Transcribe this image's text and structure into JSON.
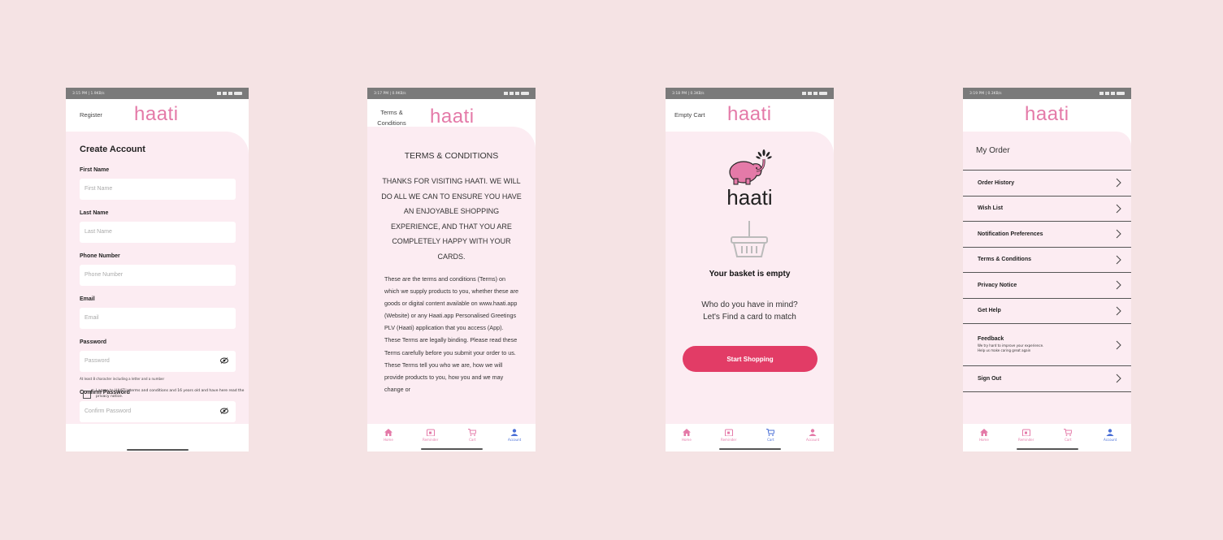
{
  "brand": {
    "logo": "haati",
    "accent": "#e47aa8",
    "button": "#e23c66",
    "active_nav": "#4a6fd6"
  },
  "screens": {
    "register": {
      "status_time": "3:15 PM | 1.9KB/s",
      "header_label": "Register",
      "title": "Create Account",
      "fields": [
        {
          "label": "First Name",
          "placeholder": "First Name"
        },
        {
          "label": "Last Name",
          "placeholder": "Last Name"
        },
        {
          "label": "Phone Number",
          "placeholder": "Phone Number"
        },
        {
          "label": "Email",
          "placeholder": "Email"
        },
        {
          "label": "Password",
          "placeholder": "Password"
        },
        {
          "label": "Confirm Password",
          "placeholder": "Confirm Password"
        }
      ],
      "password_hint": "At least 8 character including a letter and a number",
      "agree_text": "I agree to HAATI's terms and conditions and 16 years old and have here read the privacy notice."
    },
    "terms": {
      "status_time": "3:17 PM | 0.9KB/s",
      "header_label_line1": "Terms &",
      "header_label_line2": "Conditions",
      "title": "TERMS & CONDITIONS",
      "intro": "THANKS FOR VISITING HAATI. WE WILL DO ALL WE CAN TO ENSURE YOU HAVE AN ENJOYABLE SHOPPING EXPERIENCE, AND THAT YOU ARE COMPLETELY HAPPY WITH YOUR CARDS.",
      "body": "These are the terms and conditions (Terms) on which we supply products to you, whether these are goods or digital content available on www.haati.app (Website) or any Haati.app Personalised Greetings PLV (Haati) application that you access (App). These Terms are legally binding. Please read these Terms carefully before you submit your order to us. These Terms tell you who we are, how we will provide products to you, how you and we may change or"
    },
    "cart": {
      "status_time": "3:18 PM | 0.3KB/s",
      "header_label": "Empty Cart",
      "logo_big": "haati",
      "empty_title": "Your basket is empty",
      "sub_line1": "Who do you have in mind?",
      "sub_line2": "Let's Find a card to match",
      "button": "Start Shopping"
    },
    "orders": {
      "status_time": "3:19 PM | 0.3KB/s",
      "title": "My Order",
      "rows": [
        {
          "label": "Order History"
        },
        {
          "label": "Wish List"
        },
        {
          "label": "Notification Preferences"
        },
        {
          "label": "Terms & Conditions"
        },
        {
          "label": "Privacy Notice"
        },
        {
          "label": "Get Help"
        },
        {
          "label": "Feedback",
          "sub1": "We try hard to improve your experience.",
          "sub2": "Help us make caring great again"
        },
        {
          "label": "Sign Out"
        }
      ]
    }
  },
  "nav": [
    "Home",
    "Reminder",
    "Cart",
    "Account"
  ]
}
